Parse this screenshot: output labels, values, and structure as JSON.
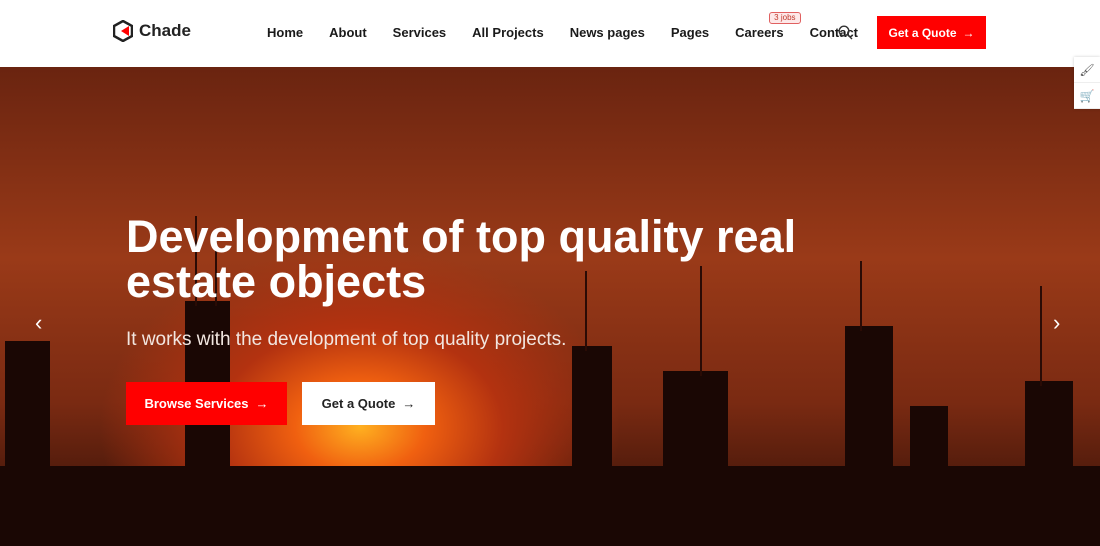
{
  "brand": {
    "name": "Chade",
    "accent": "#ff0000"
  },
  "nav": {
    "items": [
      "Home",
      "About",
      "Services",
      "All Projects",
      "News pages",
      "Pages",
      "Careers",
      "Contact"
    ],
    "careers_badge": "3 jobs"
  },
  "header": {
    "quote_label": "Get a Quote",
    "quote_arrow": "→"
  },
  "hero": {
    "title": "Development of top quality real estate objects",
    "subtitle": "It works with the development of top quality projects.",
    "primary_label": "Browse Services",
    "secondary_label": "Get a Quote",
    "arrow": "→",
    "prev": "‹",
    "next": "›"
  },
  "side_tools": [
    "paintbrush-icon",
    "cart-icon"
  ]
}
